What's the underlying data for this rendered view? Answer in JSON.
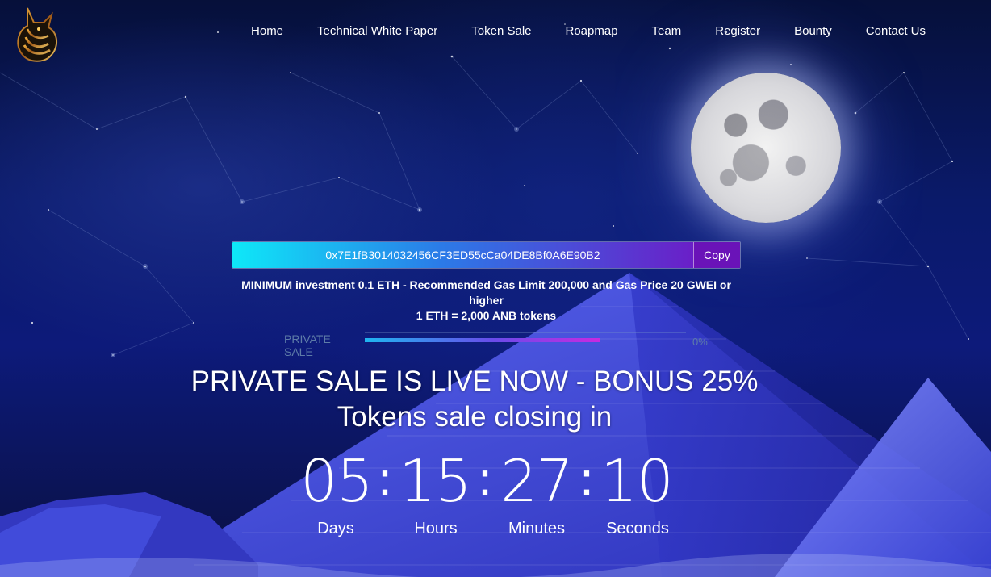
{
  "nav": {
    "items": [
      {
        "label": "Home"
      },
      {
        "label": "Technical White Paper"
      },
      {
        "label": "Token Sale"
      },
      {
        "label": "Roapmap"
      },
      {
        "label": "Team"
      },
      {
        "label": "Register"
      },
      {
        "label": "Bounty"
      },
      {
        "label": "Contact Us"
      }
    ]
  },
  "logo": {
    "icon": "anubis-logo-icon"
  },
  "wallet": {
    "address": "0x7E1fB3014032456CF3ED55cCa04DE8Bf0A6E90B2",
    "copy_label": "Copy"
  },
  "info": {
    "line1": "MINIMUM investment 0.1 ETH - Recommended Gas Limit 200,000 and Gas Price 20 GWEI or higher",
    "line2": "1 ETH = 2,000 ANB tokens"
  },
  "progress": {
    "label": "PRIVATE SALE",
    "percent_text": "0%",
    "fill_fraction": 0.73
  },
  "headline": {
    "line1": "PRIVATE SALE IS LIVE NOW - BONUS 25%",
    "line2": "Tokens sale closing in"
  },
  "countdown": {
    "days": "05",
    "hours": "15",
    "minutes": "27",
    "seconds": "10",
    "separator": ":",
    "days_label": "Days",
    "hours_label": "Hours",
    "minutes_label": "Minutes",
    "seconds_label": "Seconds"
  },
  "colors": {
    "sky_dark": "#06103a",
    "sky_mid": "#0d1a7a",
    "pyramid": "#3a44d8",
    "progress_start": "#1fb6f0",
    "progress_end": "#c82ae0",
    "address_start": "#0ee8f8",
    "address_end": "#6a1fc8"
  }
}
